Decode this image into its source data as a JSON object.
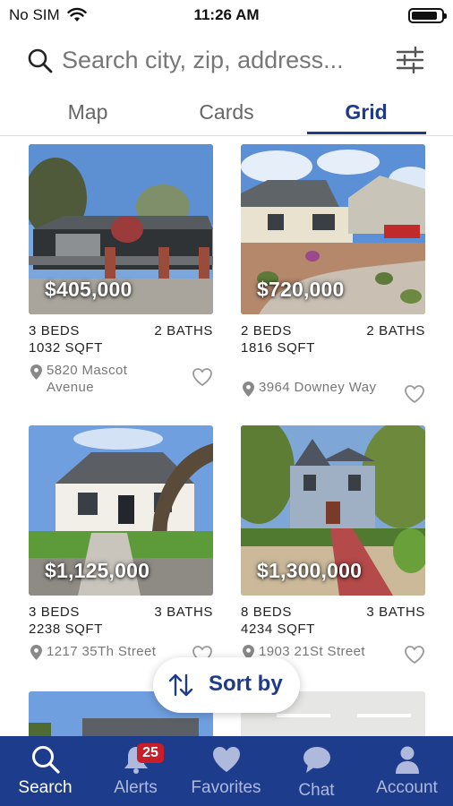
{
  "status_bar": {
    "carrier": "No SIM",
    "time": "11:26 AM"
  },
  "search": {
    "placeholder": "Search city, zip, address..."
  },
  "tabs": [
    {
      "label": "Map"
    },
    {
      "label": "Cards"
    },
    {
      "label": "Grid",
      "active": true
    }
  ],
  "listings": [
    {
      "price": "$405,000",
      "beds": "3 BEDS",
      "baths": "2 BATHS",
      "sqft": "1032 SQFT",
      "address": "5820 Mascot Avenue"
    },
    {
      "price": "$720,000",
      "beds": "2 BEDS",
      "baths": "2 BATHS",
      "sqft": "1816 SQFT",
      "address": "3964 Downey Way"
    },
    {
      "price": "$1,125,000",
      "beds": "3 BEDS",
      "baths": "3 BATHS",
      "sqft": "2238 SQFT",
      "address": "1217 35Th Street"
    },
    {
      "price": "$1,300,000",
      "beds": "8 BEDS",
      "baths": "3 BATHS",
      "sqft": "4234 SQFT",
      "address": "1903 21St Street"
    }
  ],
  "sort": {
    "label": "Sort by"
  },
  "bottom_nav": {
    "items": [
      {
        "label": "Search",
        "icon": "search-icon",
        "active": true
      },
      {
        "label": "Alerts",
        "icon": "bell-icon",
        "badge": "25"
      },
      {
        "label": "Favorites",
        "icon": "heart-icon"
      },
      {
        "label": "Chat",
        "icon": "chat-icon"
      },
      {
        "label": "Account",
        "icon": "person-icon"
      }
    ]
  },
  "colors": {
    "brand": "#1e3c8c",
    "accent": "#1f3a8a",
    "badge": "#c81e2a"
  }
}
